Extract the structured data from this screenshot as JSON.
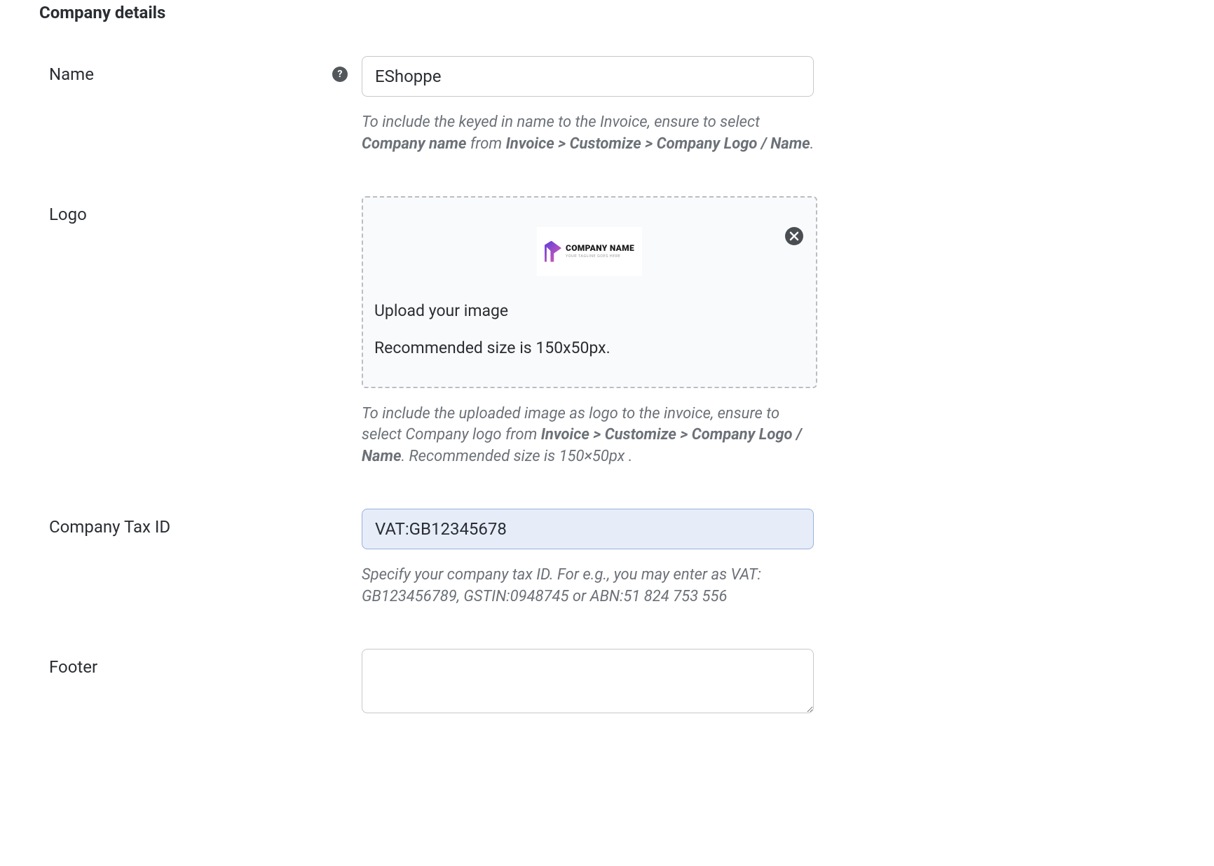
{
  "sectionTitle": "Company details",
  "name": {
    "label": "Name",
    "value": "EShoppe",
    "hintPart1": "To include the keyed in name to the Invoice, ensure to select ",
    "hintBold1": "Company name",
    "hintPart2": " from ",
    "hintBold2": "Invoice > Customize > Company Logo / Name",
    "hintPart3": "."
  },
  "logo": {
    "label": "Logo",
    "uploadText": "Upload your image",
    "sizeText": "Recommended size is 150x50px.",
    "placeholder": {
      "main": "COMPANY NAME",
      "sub": "YOUR TAGLINE GOES HERE"
    },
    "hintPart1": "To include the uploaded image as logo to the invoice, ensure to select Company logo from ",
    "hintBold1": "Invoice > Customize > Company Logo / Name",
    "hintPart2": ". Recommended size is 150×50px ."
  },
  "taxId": {
    "label": "Company Tax ID",
    "value": "VAT:GB12345678",
    "hint": "Specify your company tax ID. For e.g., you may enter as VAT: GB123456789, GSTIN:0948745 or ABN:51 824 753 556"
  },
  "footer": {
    "label": "Footer",
    "value": ""
  }
}
